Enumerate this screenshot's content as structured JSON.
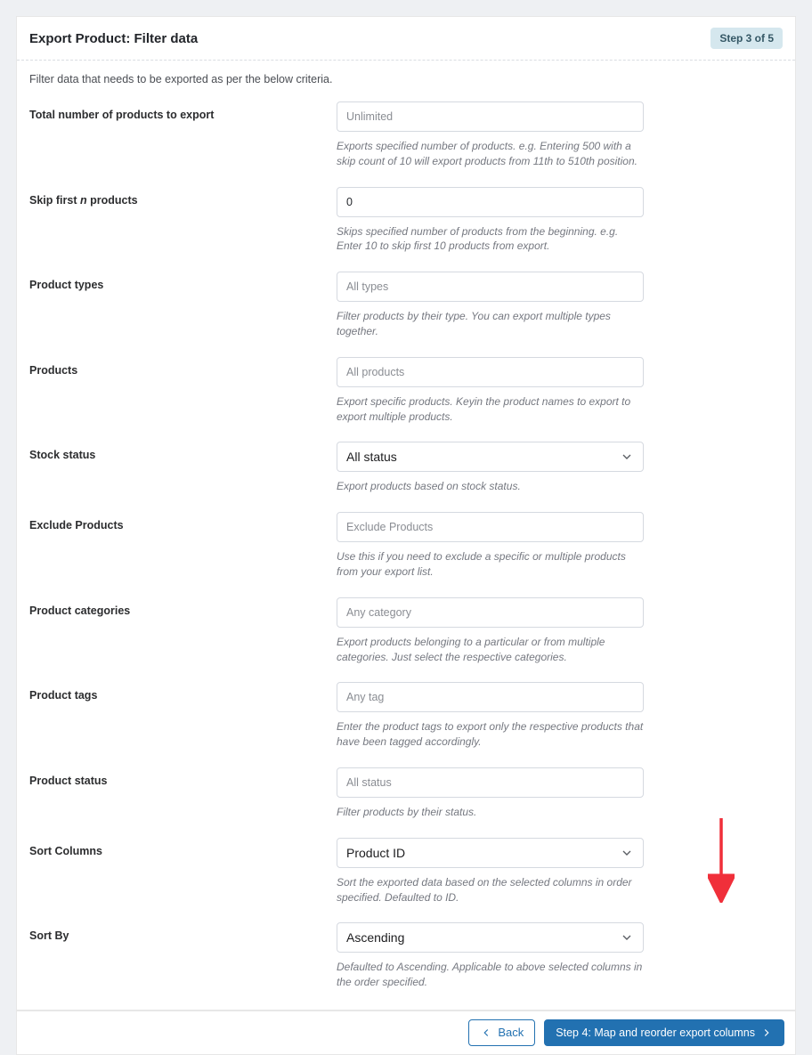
{
  "header": {
    "title": "Export Product: Filter data",
    "step_badge": "Step 3 of 5"
  },
  "intro": "Filter data that needs to be exported as per the below criteria.",
  "rows": {
    "total": {
      "label": "Total number of products to export",
      "placeholder": "Unlimited",
      "help": "Exports specified number of products. e.g. Entering 500 with a skip count of 10 will export products from 11th to 510th position."
    },
    "skip": {
      "label_pre": "Skip first ",
      "label_em": "n",
      "label_post": " products",
      "value": "0",
      "help": "Skips specified number of products from the beginning. e.g. Enter 10 to skip first 10 products from export."
    },
    "types": {
      "label": "Product types",
      "placeholder": "All types",
      "help": "Filter products by their type. You can export multiple types together."
    },
    "products": {
      "label": "Products",
      "placeholder": "All products",
      "help": "Export specific products. Keyin the product names to export to export multiple products."
    },
    "stock": {
      "label": "Stock status",
      "selected": "All status",
      "help": "Export products based on stock status."
    },
    "exclude": {
      "label": "Exclude Products",
      "placeholder": "Exclude Products",
      "help": "Use this if you need to exclude a specific or multiple products from your export list."
    },
    "categories": {
      "label": "Product categories",
      "placeholder": "Any category",
      "help": "Export products belonging to a particular or from multiple categories. Just select the respective categories."
    },
    "tags": {
      "label": "Product tags",
      "placeholder": "Any tag",
      "help": "Enter the product tags to export only the respective products that have been tagged accordingly."
    },
    "status": {
      "label": "Product status",
      "placeholder": "All status",
      "help": "Filter products by their status."
    },
    "sort_cols": {
      "label": "Sort Columns",
      "selected": "Product ID",
      "help": "Sort the exported data based on the selected columns in order specified. Defaulted to ID."
    },
    "sort_by": {
      "label": "Sort By",
      "selected": "Ascending",
      "help": "Defaulted to Ascending. Applicable to above selected columns in the order specified."
    }
  },
  "footer": {
    "back": "Back",
    "next": "Step 4: Map and reorder export columns"
  },
  "annotation": {
    "arrow_color": "#f02f3a"
  }
}
